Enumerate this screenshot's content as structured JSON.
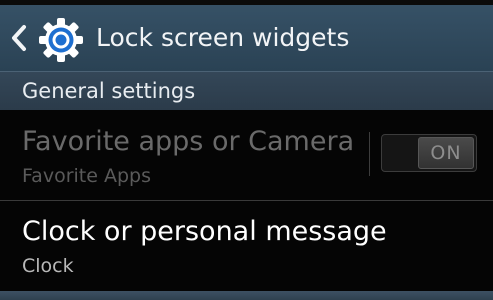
{
  "header": {
    "title": "Lock screen widgets",
    "back_icon": "chevron-left-icon",
    "app_icon": "gear-icon"
  },
  "section": {
    "title": "General settings"
  },
  "settings": [
    {
      "title": "Favorite apps or Camera",
      "subtitle": "Favorite Apps",
      "toggle_label": "ON",
      "enabled": false
    },
    {
      "title": "Clock or personal message",
      "subtitle": "Clock",
      "enabled": true
    }
  ],
  "colors": {
    "header_bg": "#2f4a5e",
    "section_bg": "#2f4151",
    "disabled_text": "#6a6a6a",
    "primary_text": "#ffffff",
    "secondary_text": "#b8b8b8",
    "gear_blue": "#1e6fd0"
  }
}
